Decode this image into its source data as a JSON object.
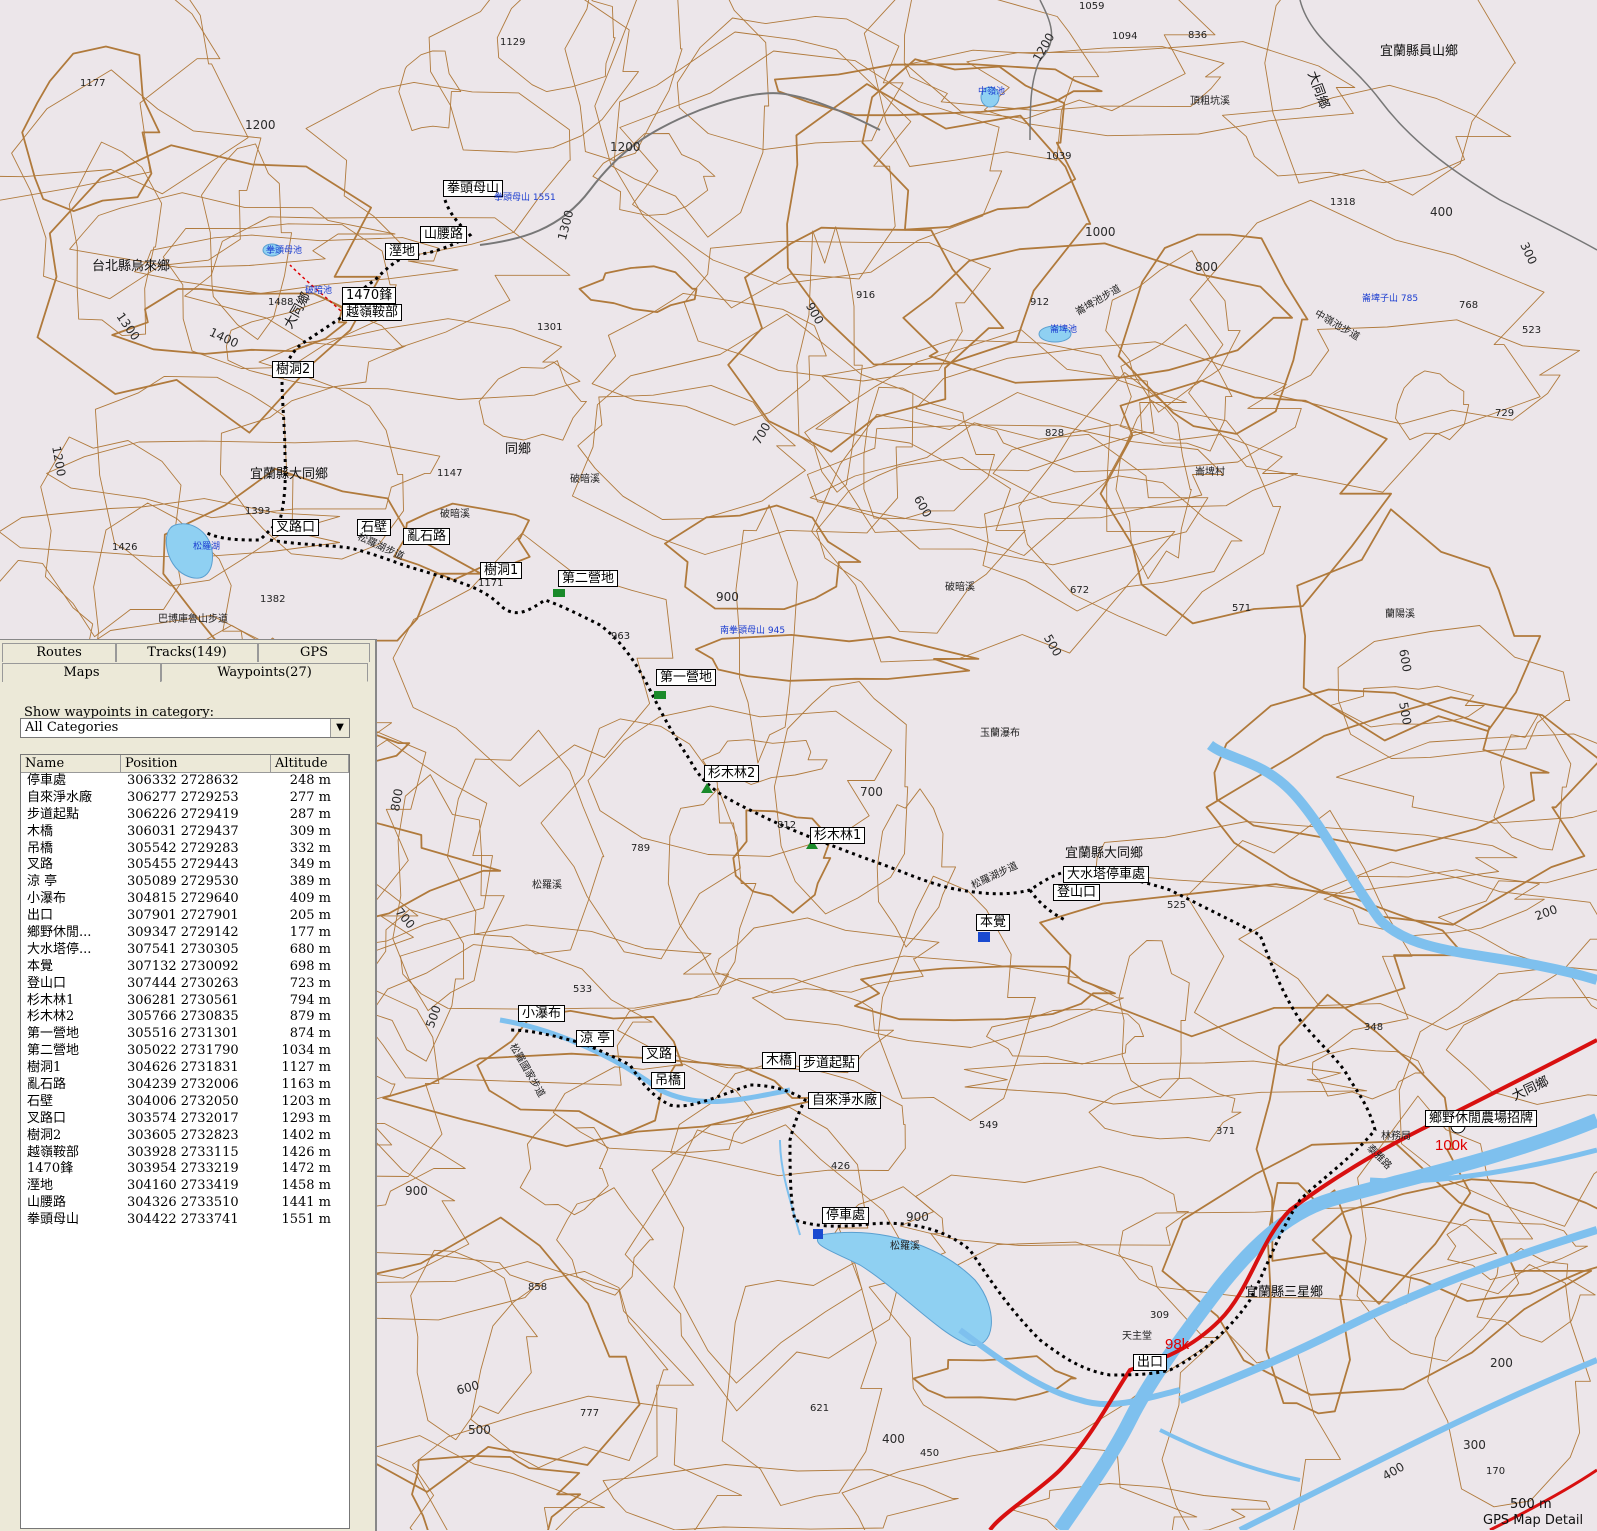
{
  "map": {
    "regions": [
      "台北縣烏來鄉",
      "宜蘭縣大同鄉",
      "宜蘭縣大同鄉",
      "宜蘭縣員山鄉",
      "宜蘭縣三星鄉",
      "同鄉",
      "大同鄉",
      "大同鄉",
      "大同鄉"
    ],
    "trails": [
      "松羅湖步道",
      "巴博庫魯山步道",
      "崙埤池步道",
      "中嶺池步道",
      "松羅湖步道",
      "松羅國家步道",
      "泰雅路"
    ],
    "streams": [
      "松羅溪",
      "破暗溪",
      "破暗溪",
      "蘭陽溪",
      "松羅溪",
      "頂粗坑溪",
      "破暗溪"
    ],
    "peaks": [
      "拳頭母山 1551",
      "南拳頭母山 945",
      "崙埤子山 785",
      "中嶺池",
      "崙埤池",
      "松羅湖",
      "拳頭母池",
      "破暗池"
    ],
    "villages": [
      "崙埤村",
      "玉蘭瀑布",
      "天主堂",
      "林務局"
    ],
    "spot_heights": [
      "1129",
      "1094",
      "1059",
      "836",
      "1039",
      "1318",
      "1177",
      "1488",
      "1301",
      "916",
      "912",
      "768",
      "523",
      "729",
      "828",
      "1147",
      "1393",
      "1426",
      "1382",
      "1171",
      "963",
      "672",
      "571",
      "812",
      "789",
      "525",
      "533",
      "549",
      "426",
      "371",
      "348",
      "858",
      "777",
      "621",
      "450",
      "170",
      "309"
    ],
    "contours": [
      "1200",
      "1200",
      "1300",
      "1400",
      "1300",
      "1200",
      "1000",
      "900",
      "800",
      "700",
      "600",
      "500",
      "400",
      "300",
      "200",
      "800",
      "700",
      "600",
      "500",
      "900",
      "900",
      "600",
      "500",
      "400",
      "300",
      "200",
      "700",
      "1200",
      "900",
      "500",
      "400"
    ],
    "km_markers": [
      "98k",
      "100k"
    ],
    "waypoint_labels": [
      "拳頭母山",
      "山腰路",
      "溼地",
      "1470鋒",
      "越嶺鞍部",
      "樹洞2",
      "叉路口",
      "石壁",
      "亂石路",
      "樹洞1",
      "第二營地",
      "第一營地",
      "杉木林2",
      "杉木林1",
      "大水塔停車處",
      "登山口",
      "本覺",
      "小瀑布",
      "涼 亭",
      "叉路",
      "吊橋",
      "木橋",
      "步道起點",
      "自來淨水廠",
      "停車處",
      "出口",
      "鄉野休閒農場招牌"
    ],
    "scale_label": "500 m",
    "footer": "GPS Map Detail",
    "colors": {
      "contour": "#b07a3c",
      "water": "#7ec0ee",
      "lake": "#8fd0f2",
      "road": "#d81010",
      "track": "#000000"
    }
  },
  "panel": {
    "tabs_row1": [
      "Routes",
      "Tracks(149)",
      "GPS"
    ],
    "tabs_row2": [
      "Maps",
      "Waypoints(27)"
    ],
    "active_tab": "Waypoints(27)",
    "show_label": "Show waypoints in category:",
    "category": "All Categories",
    "columns": [
      "Name",
      "Position",
      "Altitude"
    ],
    "rows": [
      [
        "停車處",
        "306332 2728632",
        "248 m"
      ],
      [
        "自來淨水廠",
        "306277 2729253",
        "277 m"
      ],
      [
        "步道起點",
        "306226 2729419",
        "287 m"
      ],
      [
        "木橋",
        "306031 2729437",
        "309 m"
      ],
      [
        "吊橋",
        "305542 2729283",
        "332 m"
      ],
      [
        "叉路",
        "305455 2729443",
        "349 m"
      ],
      [
        "涼 亭",
        "305089 2729530",
        "389 m"
      ],
      [
        "小瀑布",
        "304815 2729640",
        "409 m"
      ],
      [
        "出口",
        "307901 2727901",
        "205 m"
      ],
      [
        "鄉野休閒...",
        "309347 2729142",
        "177 m"
      ],
      [
        "大水塔停...",
        "307541 2730305",
        "680 m"
      ],
      [
        "本覺",
        "307132 2730092",
        "698 m"
      ],
      [
        "登山口",
        "307444 2730263",
        "723 m"
      ],
      [
        "杉木林1",
        "306281 2730561",
        "794 m"
      ],
      [
        "杉木林2",
        "305766 2730835",
        "879 m"
      ],
      [
        "第一營地",
        "305516 2731301",
        "874 m"
      ],
      [
        "第二營地",
        "305022 2731790",
        "1034 m"
      ],
      [
        "樹洞1",
        "304626 2731831",
        "1127 m"
      ],
      [
        "亂石路",
        "304239 2732006",
        "1163 m"
      ],
      [
        "石壁",
        "304006 2732050",
        "1203 m"
      ],
      [
        "叉路口",
        "303574 2732017",
        "1293 m"
      ],
      [
        "樹洞2",
        "303605 2732823",
        "1402 m"
      ],
      [
        "越嶺鞍部",
        "303928 2733115",
        "1426 m"
      ],
      [
        "1470鋒",
        "303954 2733219",
        "1472 m"
      ],
      [
        "溼地",
        "304160 2733419",
        "1458 m"
      ],
      [
        "山腰路",
        "304326 2733510",
        "1441 m"
      ],
      [
        "拳頭母山",
        "304422 2733741",
        "1551 m"
      ]
    ]
  }
}
